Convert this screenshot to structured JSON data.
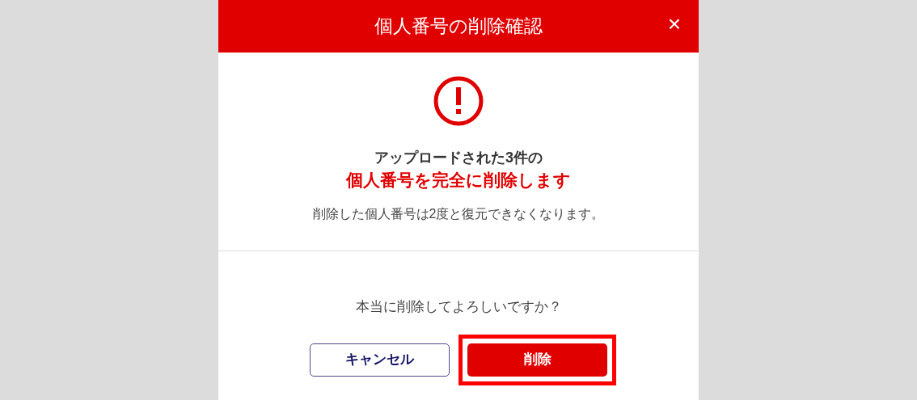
{
  "dialog": {
    "title": "個人番号の削除確認",
    "close": "×",
    "heading": "アップロードされた3件の",
    "warning": "個人番号を完全に削除します",
    "note": "削除した個人番号は2度と復元できなくなります。",
    "question": "本当に削除してよろしいですか？",
    "buttons": [
      {
        "kind": "secondary",
        "label": "キャンセル",
        "highlighted": false
      },
      {
        "kind": "danger",
        "label": "削除",
        "highlighted": true
      }
    ]
  }
}
